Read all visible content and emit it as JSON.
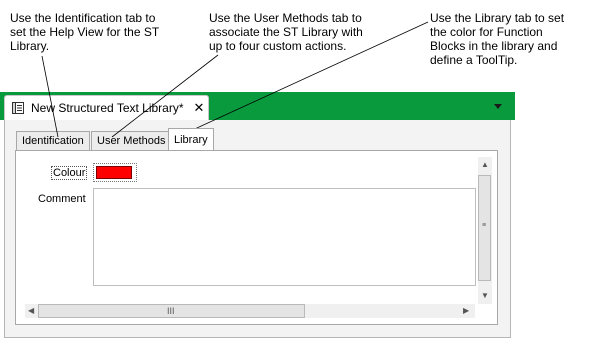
{
  "callouts": {
    "identification": "Use the Identification tab to set the Help View for the ST Library.",
    "user_methods": "Use the User Methods tab to associate the ST Library with up to four custom actions.",
    "library": "Use the Library tab to set the color for Function Blocks in the library and define a ToolTip."
  },
  "document_tab": {
    "title": "New Structured Text Library*",
    "close_glyph": "✕",
    "icon": "document-icon"
  },
  "tabs": [
    {
      "label": "Identification"
    },
    {
      "label": "User Methods"
    },
    {
      "label": "Library",
      "active": true
    }
  ],
  "form": {
    "colour_label": "Colour",
    "colour_value": "#ff0000",
    "comment_label": "Comment",
    "comment_value": ""
  },
  "scrollbars": {
    "vertical_grip": "≡",
    "horizontal_grip": "III"
  },
  "colors": {
    "accent_bar": "#0a9a3e"
  }
}
